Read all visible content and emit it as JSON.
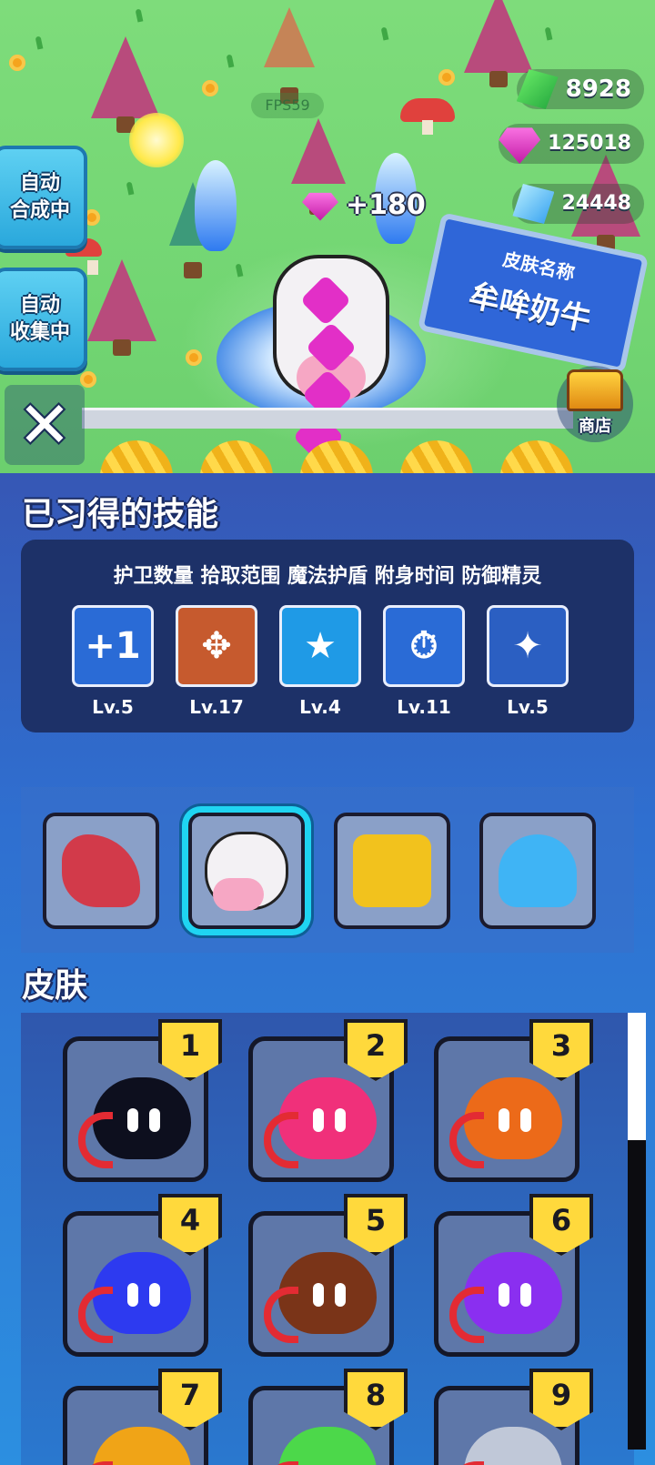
{
  "hud": {
    "fps": "FPS59",
    "auto_merge": "自动\n合成中",
    "auto_collect": "自动\n收集中",
    "close_label": "✕",
    "shop_label": "商店",
    "gain_popup": "+180",
    "sign_title": "皮肤名称",
    "sign_name": "牟哞奶牛"
  },
  "currencies": [
    {
      "icon": "green-gem-icon",
      "value": "8928"
    },
    {
      "icon": "pink-gem-icon",
      "value": "125018"
    },
    {
      "icon": "blue-crystal-icon",
      "value": "24448"
    }
  ],
  "skills_section": {
    "title": "已习得的技能",
    "names": "护卫数量 拾取范围 魔法护盾 附身时间 防御精灵",
    "skills": [
      {
        "icon": "guard-count-icon",
        "glyph": "+1",
        "level": "Lv.5",
        "color": "#2a6bd6"
      },
      {
        "icon": "pickup-range-icon",
        "glyph": "✥",
        "level": "Lv.17",
        "color": "#c65a2e"
      },
      {
        "icon": "magic-shield-icon",
        "glyph": "★",
        "level": "Lv.4",
        "color": "#1f9ae6"
      },
      {
        "icon": "possess-time-icon",
        "glyph": "⏱",
        "level": "Lv.11",
        "color": "#2a6bd6"
      },
      {
        "icon": "defense-sprite-icon",
        "glyph": "✦",
        "level": "Lv.5",
        "color": "#2b5fc2"
      }
    ]
  },
  "pets": [
    {
      "icon": "red-dragon-icon",
      "color": "#d23a4a",
      "selected": false
    },
    {
      "icon": "cow-icon",
      "color": "#f3f1f4",
      "selected": true
    },
    {
      "icon": "yellow-drone-icon",
      "color": "#f2c21d",
      "selected": false
    },
    {
      "icon": "blue-octopus-icon",
      "color": "#3fb4f5",
      "selected": false
    }
  ],
  "skins_section": {
    "title": "皮肤",
    "skins": [
      {
        "number": "1",
        "color": "#0d0f1e"
      },
      {
        "number": "2",
        "color": "#f0307a"
      },
      {
        "number": "3",
        "color": "#ec6a19"
      },
      {
        "number": "4",
        "color": "#2d3af0"
      },
      {
        "number": "5",
        "color": "#7a3418"
      },
      {
        "number": "6",
        "color": "#8a2ff0"
      },
      {
        "number": "7",
        "color": "#f0a417"
      },
      {
        "number": "8",
        "color": "#4cd84a"
      },
      {
        "number": "9",
        "color": "#c0c8d8"
      }
    ]
  }
}
